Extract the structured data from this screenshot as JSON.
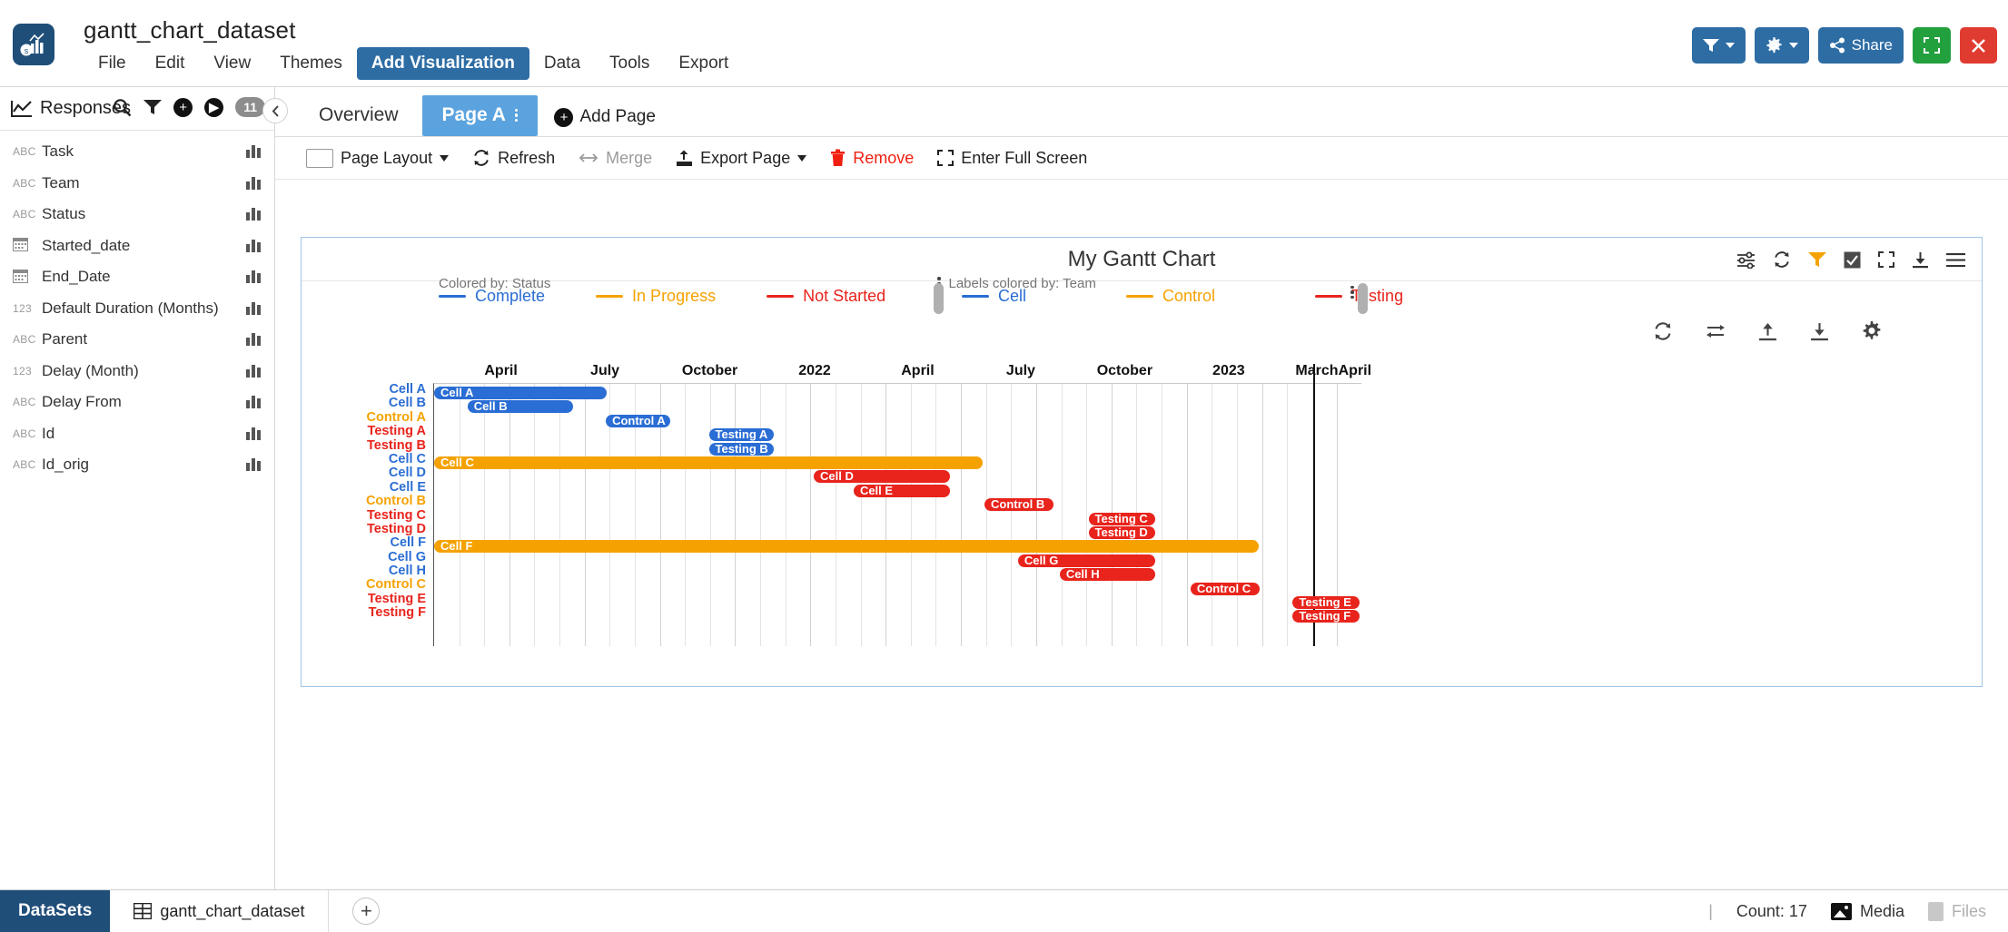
{
  "app": {
    "title": "gantt_chart_dataset",
    "logo_icon": "chart-logo-icon",
    "menu": [
      {
        "label": "File",
        "active": false
      },
      {
        "label": "Edit",
        "active": false
      },
      {
        "label": "View",
        "active": false
      },
      {
        "label": "Themes",
        "active": false
      },
      {
        "label": "Add Visualization",
        "active": true
      },
      {
        "label": "Data",
        "active": false
      },
      {
        "label": "Tools",
        "active": false
      },
      {
        "label": "Export",
        "active": false
      }
    ],
    "top_actions": [
      {
        "name": "filter-button",
        "icon": "filter-icon",
        "label": "",
        "color": "#2e6da4",
        "caret": true
      },
      {
        "name": "settings-button",
        "icon": "gear-icon",
        "label": "",
        "color": "#2e6da4",
        "caret": true
      },
      {
        "name": "share-button",
        "icon": "share-icon",
        "label": "Share",
        "color": "#2e6da4",
        "caret": false
      },
      {
        "name": "fullscreen-button",
        "icon": "fullscreen-icon",
        "label": "",
        "color": "#23a03e",
        "caret": false
      },
      {
        "name": "close-button",
        "icon": "close-icon",
        "label": "",
        "color": "#e03b31",
        "caret": false
      }
    ]
  },
  "sidebar": {
    "title": "Responses",
    "title_icon": "line-chart-icon",
    "tools": {
      "search_icon": "search-icon",
      "filter_icon": "filter-icon",
      "add_icon": "plus-circle-icon",
      "play_icon": "play-circle-icon",
      "count_badge": "11"
    },
    "fields": [
      {
        "type": "ABC",
        "name": "Task"
      },
      {
        "type": "ABC",
        "name": "Team"
      },
      {
        "type": "ABC",
        "name": "Status"
      },
      {
        "type": "CAL",
        "name": "Started_date"
      },
      {
        "type": "CAL",
        "name": "End_Date"
      },
      {
        "type": "123",
        "name": "Default Duration (Months)"
      },
      {
        "type": "ABC",
        "name": "Parent"
      },
      {
        "type": "123",
        "name": "Delay (Month)"
      },
      {
        "type": "ABC",
        "name": "Delay From"
      },
      {
        "type": "ABC",
        "name": "Id"
      },
      {
        "type": "ABC",
        "name": "Id_orig"
      }
    ],
    "collapse_icon": "chevron-left-icon"
  },
  "page_tabs": [
    {
      "label": "Overview",
      "active": false,
      "kebab": false
    },
    {
      "label": "Page A",
      "active": true,
      "kebab": true
    }
  ],
  "add_page": {
    "label": "Add Page",
    "icon": "plus-circle-icon"
  },
  "page_toolbar": [
    {
      "name": "page-layout-button",
      "label": "Page Layout",
      "icon": "layout-swatch-icon",
      "caret": true,
      "state": "normal"
    },
    {
      "name": "refresh-button",
      "label": "Refresh",
      "icon": "refresh-icon",
      "caret": false,
      "state": "normal"
    },
    {
      "name": "merge-button",
      "label": "Merge",
      "icon": "merge-arrows-icon",
      "caret": false,
      "state": "disabled"
    },
    {
      "name": "export-page-button",
      "label": "Export Page",
      "icon": "export-icon",
      "caret": true,
      "state": "normal"
    },
    {
      "name": "remove-button",
      "label": "Remove",
      "icon": "trash-icon",
      "caret": false,
      "state": "danger"
    },
    {
      "name": "enter-full-screen-button",
      "label": "Enter Full Screen",
      "icon": "fullscreen-icon",
      "caret": false,
      "state": "normal"
    }
  ],
  "chart_card": {
    "title": "My Gantt Chart",
    "header_icons": [
      "sliders-icon",
      "refresh-icon",
      "filter-icon",
      "checkbox-icon",
      "fullscreen-icon",
      "download-icon",
      "hamburger-icon"
    ],
    "mini_toolbar_icons": [
      "refresh-icon",
      "swap-icon",
      "upload-icon",
      "download-icon",
      "gear-icon"
    ],
    "legend_left_caption": "Colored by: Status",
    "legend_right_caption": "Labels colored by: Team"
  },
  "chart_data": {
    "type": "bar",
    "chart_subtype": "gantt",
    "title": "My Gantt Chart",
    "xlabel": "",
    "ylabel": "",
    "grid": true,
    "legend_position": "top",
    "colored_by": "Status",
    "labels_colored_by": "Team",
    "status_legend": [
      {
        "name": "Complete",
        "color": "#2a6dd4"
      },
      {
        "name": "In Progress",
        "color": "#f5a200"
      },
      {
        "name": "Not Started",
        "color": "#e8241c"
      }
    ],
    "team_legend": [
      {
        "name": "Cell",
        "color": "#2a6dd4"
      },
      {
        "name": "Control",
        "color": "#f5a200"
      },
      {
        "name": "Testing",
        "color": "#e8241c"
      }
    ],
    "axis_ticks": [
      {
        "label": "April",
        "pos": 0.073
      },
      {
        "label": "July",
        "pos": 0.185
      },
      {
        "label": "October",
        "pos": 0.298
      },
      {
        "label": "2022",
        "pos": 0.411
      },
      {
        "label": "April",
        "pos": 0.522
      },
      {
        "label": "July",
        "pos": 0.633
      },
      {
        "label": "October",
        "pos": 0.745
      },
      {
        "label": "2023",
        "pos": 0.857
      },
      {
        "label": "March",
        "pos": 0.952
      },
      {
        "label": "April",
        "pos": 0.993
      }
    ],
    "today_marker_pos": 0.947,
    "categories": [
      "Cell A",
      "Cell B",
      "Control A",
      "Testing A",
      "Testing B",
      "Cell C",
      "Cell D",
      "Cell E",
      "Control B",
      "Testing C",
      "Testing D",
      "Cell F",
      "Cell G",
      "Cell H",
      "Control C",
      "Testing E",
      "Testing F"
    ],
    "tasks": [
      {
        "task": "Cell A",
        "team": "Cell",
        "status": "Complete",
        "label_color": "#2a6dd4",
        "bar_color": "#2a6dd4",
        "start": 0.0,
        "end": 0.186
      },
      {
        "task": "Cell B",
        "team": "Cell",
        "status": "Complete",
        "label_color": "#2a6dd4",
        "bar_color": "#2a6dd4",
        "start": 0.036,
        "end": 0.15
      },
      {
        "task": "Control A",
        "team": "Control",
        "status": "Complete",
        "label_color": "#f5a200",
        "bar_color": "#2a6dd4",
        "start": 0.185,
        "end": 0.254
      },
      {
        "task": "Testing A",
        "team": "Testing",
        "status": "Complete",
        "label_color": "#e8241c",
        "bar_color": "#2a6dd4",
        "start": 0.296,
        "end": 0.366
      },
      {
        "task": "Testing B",
        "team": "Testing",
        "status": "Complete",
        "label_color": "#e8241c",
        "bar_color": "#2a6dd4",
        "start": 0.296,
        "end": 0.366
      },
      {
        "task": "Cell C",
        "team": "Cell",
        "status": "In Progress",
        "label_color": "#2a6dd4",
        "bar_color": "#f5a200",
        "start": 0.0,
        "end": 0.591
      },
      {
        "task": "Cell D",
        "team": "Cell",
        "status": "Not Started",
        "label_color": "#2a6dd4",
        "bar_color": "#e8241c",
        "start": 0.409,
        "end": 0.556
      },
      {
        "task": "Cell E",
        "team": "Cell",
        "status": "Not Started",
        "label_color": "#2a6dd4",
        "bar_color": "#e8241c",
        "start": 0.452,
        "end": 0.556
      },
      {
        "task": "Control B",
        "team": "Control",
        "status": "Not Started",
        "label_color": "#f5a200",
        "bar_color": "#e8241c",
        "start": 0.593,
        "end": 0.667
      },
      {
        "task": "Testing C",
        "team": "Testing",
        "status": "Not Started",
        "label_color": "#e8241c",
        "bar_color": "#e8241c",
        "start": 0.705,
        "end": 0.777
      },
      {
        "task": "Testing D",
        "team": "Testing",
        "status": "Not Started",
        "label_color": "#e8241c",
        "bar_color": "#e8241c",
        "start": 0.705,
        "end": 0.777
      },
      {
        "task": "Cell F",
        "team": "Cell",
        "status": "In Progress",
        "label_color": "#2a6dd4",
        "bar_color": "#f5a200",
        "start": 0.0,
        "end": 0.888
      },
      {
        "task": "Cell G",
        "team": "Cell",
        "status": "Not Started",
        "label_color": "#2a6dd4",
        "bar_color": "#e8241c",
        "start": 0.629,
        "end": 0.777
      },
      {
        "task": "Cell H",
        "team": "Cell",
        "status": "Not Started",
        "label_color": "#2a6dd4",
        "bar_color": "#e8241c",
        "start": 0.674,
        "end": 0.777
      },
      {
        "task": "Control C",
        "team": "Control",
        "status": "Not Started",
        "label_color": "#f5a200",
        "bar_color": "#e8241c",
        "start": 0.815,
        "end": 0.889
      },
      {
        "task": "Testing E",
        "team": "Testing",
        "status": "Not Started",
        "label_color": "#e8241c",
        "bar_color": "#e8241c",
        "start": 0.925,
        "end": 0.997
      },
      {
        "task": "Testing F",
        "team": "Testing",
        "status": "Not Started",
        "label_color": "#e8241c",
        "bar_color": "#e8241c",
        "start": 0.925,
        "end": 0.997
      }
    ]
  },
  "bottom_bar": {
    "datasets_label": "DataSets",
    "dataset_name": "gantt_chart_dataset",
    "dataset_icon": "grid-icon",
    "add_dataset_icon": "plus-icon",
    "count_label": "Count: 17",
    "media_label": "Media",
    "media_icon": "image-icon",
    "files_label": "Files",
    "files_icon": "file-icon"
  }
}
